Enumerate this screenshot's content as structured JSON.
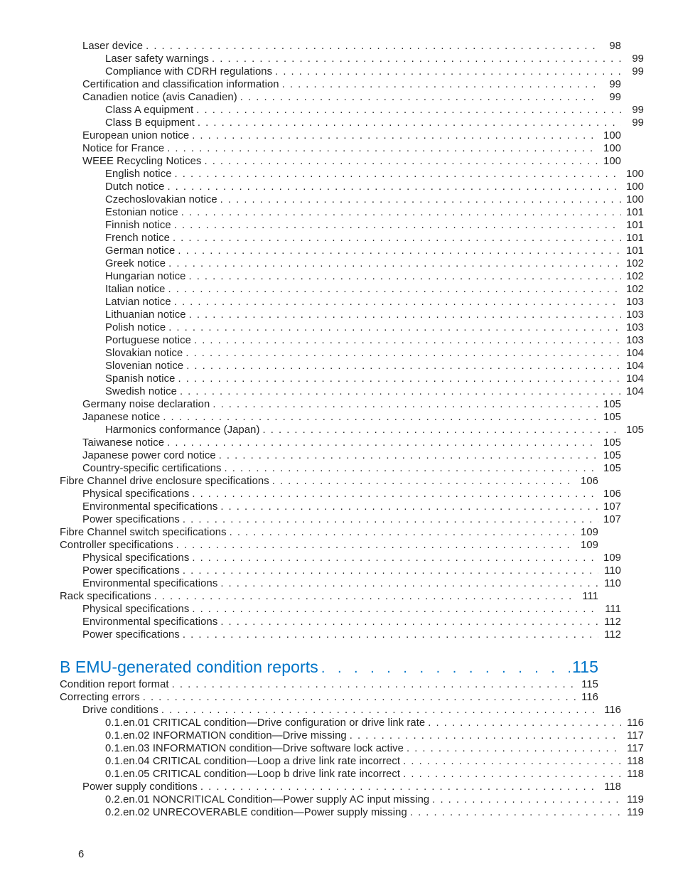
{
  "page_number": "6",
  "toc": [
    {
      "label": "Laser device",
      "page": "98",
      "indent": 1
    },
    {
      "label": "Laser safety warnings",
      "page": "99",
      "indent": 2
    },
    {
      "label": "Compliance with CDRH regulations",
      "page": "99",
      "indent": 2
    },
    {
      "label": "Certification and classification information",
      "page": "99",
      "indent": 1
    },
    {
      "label": "Canadien notice (avis Canadien)",
      "page": "99",
      "indent": 1
    },
    {
      "label": "Class A equipment",
      "page": "99",
      "indent": 2
    },
    {
      "label": "Class B equipment",
      "page": "99",
      "indent": 2
    },
    {
      "label": "European union notice",
      "page": "100",
      "indent": 1
    },
    {
      "label": "Notice for France",
      "page": "100",
      "indent": 1
    },
    {
      "label": "WEEE Recycling Notices",
      "page": "100",
      "indent": 1
    },
    {
      "label": "English notice",
      "page": "100",
      "indent": 2
    },
    {
      "label": "Dutch notice",
      "page": "100",
      "indent": 2
    },
    {
      "label": "Czechoslovakian notice",
      "page": "100",
      "indent": 2
    },
    {
      "label": "Estonian notice",
      "page": "101",
      "indent": 2
    },
    {
      "label": "Finnish notice",
      "page": "101",
      "indent": 2
    },
    {
      "label": "French notice",
      "page": "101",
      "indent": 2
    },
    {
      "label": "German notice",
      "page": "101",
      "indent": 2
    },
    {
      "label": "Greek notice",
      "page": "102",
      "indent": 2
    },
    {
      "label": "Hungarian notice",
      "page": "102",
      "indent": 2
    },
    {
      "label": "Italian notice",
      "page": "102",
      "indent": 2
    },
    {
      "label": "Latvian notice",
      "page": "103",
      "indent": 2
    },
    {
      "label": "Lithuanian notice",
      "page": "103",
      "indent": 2
    },
    {
      "label": "Polish notice",
      "page": "103",
      "indent": 2
    },
    {
      "label": "Portuguese notice",
      "page": "103",
      "indent": 2
    },
    {
      "label": "Slovakian notice",
      "page": "104",
      "indent": 2
    },
    {
      "label": "Slovenian notice",
      "page": "104",
      "indent": 2
    },
    {
      "label": "Spanish notice",
      "page": "104",
      "indent": 2
    },
    {
      "label": "Swedish notice",
      "page": "104",
      "indent": 2
    },
    {
      "label": "Germany noise declaration",
      "page": "105",
      "indent": 1
    },
    {
      "label": "Japanese notice",
      "page": "105",
      "indent": 1
    },
    {
      "label": "Harmonics conformance (Japan)",
      "page": "105",
      "indent": 2
    },
    {
      "label": "Taiwanese notice",
      "page": "105",
      "indent": 1
    },
    {
      "label": "Japanese power cord notice",
      "page": "105",
      "indent": 1
    },
    {
      "label": "Country-specific certifications",
      "page": "105",
      "indent": 1
    },
    {
      "label": "Fibre Channel drive enclosure specifications",
      "page": "106",
      "indent": 0
    },
    {
      "label": "Physical specifications",
      "page": "106",
      "indent": 1
    },
    {
      "label": "Environmental specifications",
      "page": "107",
      "indent": 1
    },
    {
      "label": "Power specifications",
      "page": "107",
      "indent": 1
    },
    {
      "label": "Fibre Channel switch specifications",
      "page": "109",
      "indent": 0
    },
    {
      "label": "Controller specifications",
      "page": "109",
      "indent": 0
    },
    {
      "label": "Physical specifications",
      "page": "109",
      "indent": 1
    },
    {
      "label": "Power specifications",
      "page": "110",
      "indent": 1
    },
    {
      "label": "Environmental specifications",
      "page": "110",
      "indent": 1
    },
    {
      "label": "Rack specifications",
      "page": "111",
      "indent": 0
    },
    {
      "label": "Physical specifications",
      "page": "111",
      "indent": 1
    },
    {
      "label": "Environmental specifications",
      "page": "112",
      "indent": 1
    },
    {
      "label": "Power specifications",
      "page": "112",
      "indent": 1
    }
  ],
  "section_b": {
    "label": "B EMU-generated condition reports",
    "page": "115"
  },
  "toc_b": [
    {
      "label": "Condition report format",
      "page": "115",
      "indent": 0
    },
    {
      "label": "Correcting errors",
      "page": "116",
      "indent": 0
    },
    {
      "label": "Drive conditions",
      "page": "116",
      "indent": 1
    },
    {
      "label": "0.1.en.01 CRITICAL condition—Drive configuration or drive link rate",
      "page": "116",
      "indent": 2
    },
    {
      "label": "0.1.en.02 INFORMATION condition—Drive missing",
      "page": "117",
      "indent": 2
    },
    {
      "label": "0.1.en.03 INFORMATION condition—Drive software lock active",
      "page": "117",
      "indent": 2
    },
    {
      "label": "0.1.en.04 CRITICAL condition—Loop a drive link rate incorrect",
      "page": "118",
      "indent": 2
    },
    {
      "label": "0.1.en.05 CRITICAL condition—Loop b drive link rate incorrect",
      "page": "118",
      "indent": 2
    },
    {
      "label": "Power supply conditions",
      "page": "118",
      "indent": 1
    },
    {
      "label": "0.2.en.01 NONCRITICAL Condition—Power supply AC input missing",
      "page": "119",
      "indent": 2
    },
    {
      "label": "0.2.en.02 UNRECOVERABLE condition—Power supply missing",
      "page": "119",
      "indent": 2
    }
  ]
}
